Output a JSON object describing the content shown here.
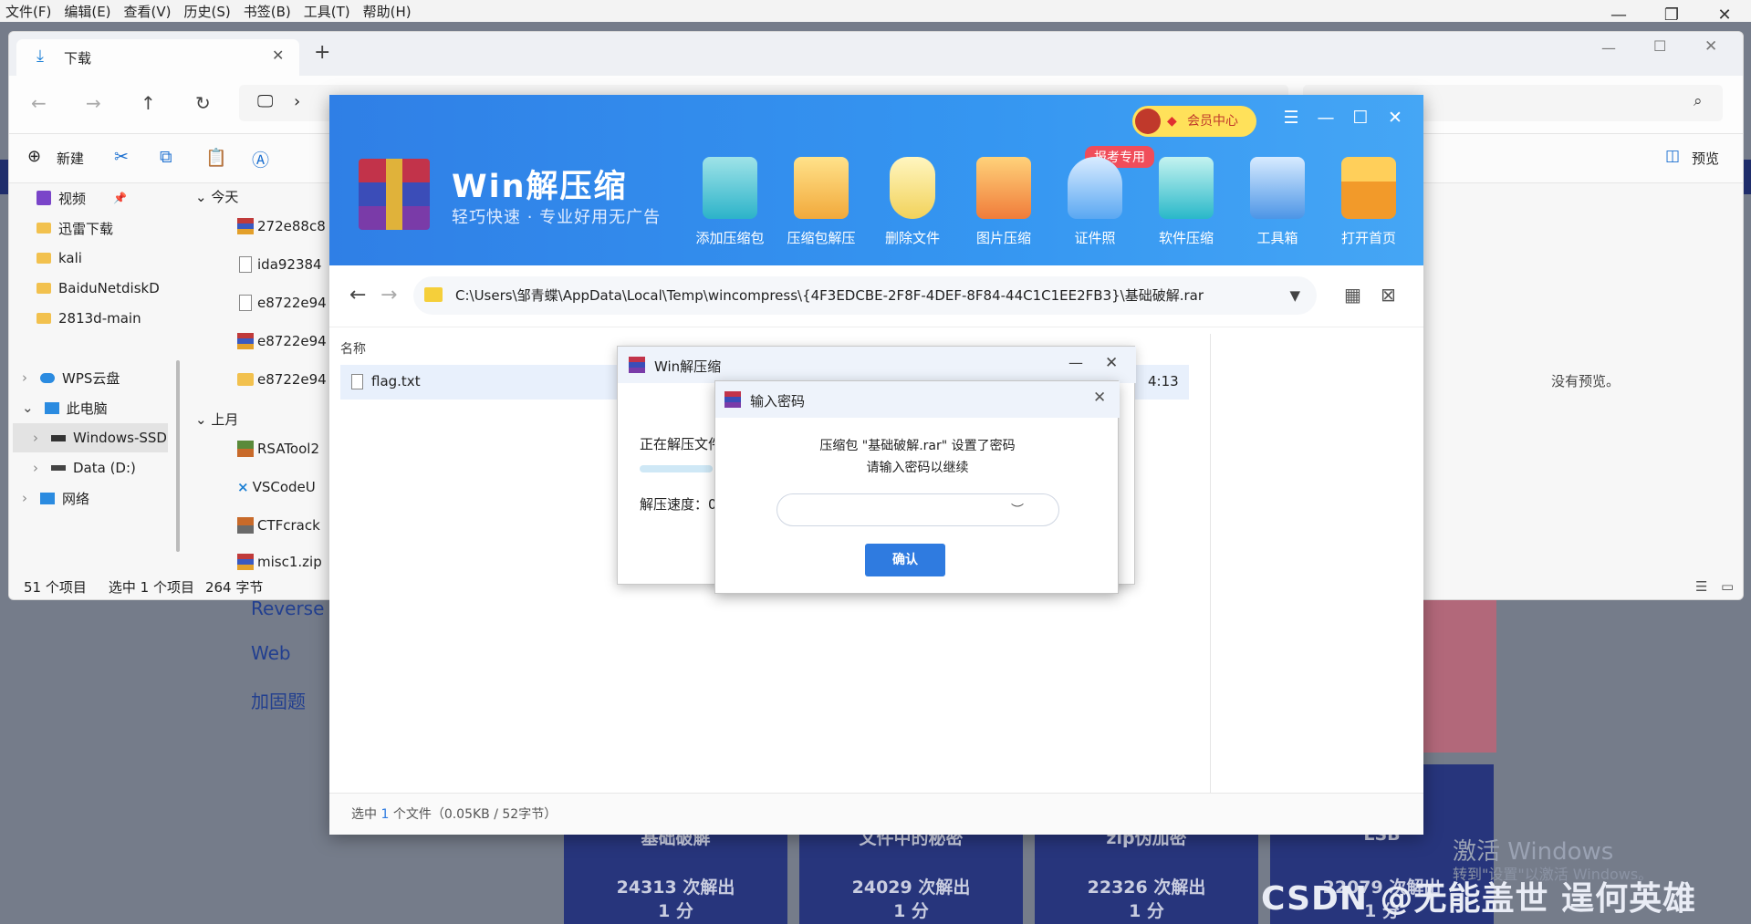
{
  "menu": [
    "文件(F)",
    "编辑(E)",
    "查看(V)",
    "历史(S)",
    "书签(B)",
    "工具(T)",
    "帮助(H)"
  ],
  "window_caps": [
    "—",
    "❐",
    "✕"
  ],
  "ctf": {
    "links": [
      "Reverse",
      "Web",
      "加固题"
    ],
    "cards": [
      {
        "title": "基础破解",
        "solves": "24313 次解出",
        "score": "1 分"
      },
      {
        "title": "文件中的秘密",
        "solves": "24029 次解出",
        "score": "1 分"
      },
      {
        "title": "zip伪加密",
        "solves": "22326 次解出",
        "score": "1 分"
      },
      {
        "title": "LSB",
        "solves": "22079 次解出",
        "score": "1 分"
      }
    ]
  },
  "watermark": {
    "activate": "激活 Windows",
    "activate_sub": "转到\"设置\"以激活 Windows。",
    "csdn": "CSDN @无能盖世 逞何英雄"
  },
  "explorer": {
    "tab_title": "下载",
    "new_button": "新建",
    "preview_button": "预览",
    "no_preview": "没有预览。",
    "sidebar": [
      "视频",
      "迅雷下载",
      "kali",
      "BaiduNetdiskD",
      "2813d-main",
      "WPS云盘",
      "此电脑",
      "Windows-SSD",
      "Data (D:)",
      "网络"
    ],
    "groups": [
      "今天",
      "上月"
    ],
    "files_today": [
      "272e88c8",
      "ida92384",
      "e8722e94",
      "e8722e94",
      "e8722e94"
    ],
    "files_month": [
      "RSATool2",
      "VSCodeU",
      "CTFcrack",
      "misc1.zip"
    ],
    "status": {
      "count": "51 个项目",
      "selected": "选中 1 个项目",
      "size": "264 字节"
    }
  },
  "winrar": {
    "title": "Win解压缩",
    "subtitle": "轻巧快速 · 专业好用无广告",
    "vip": "会员中心",
    "tag": "报考专用",
    "tools": [
      "添加压缩包",
      "压缩包解压",
      "删除文件",
      "图片压缩",
      "证件照",
      "软件压缩",
      "工具箱",
      "打开首页"
    ],
    "path": "C:\\Users\\邹青蝶\\AppData\\Local\\Temp\\wincompress\\{4F3EDCBE-2F8F-4DEF-8F84-44C1C1EE2FB3}\\基础破解.rar",
    "col_name": "名称",
    "file_name": "flag.txt",
    "file_time": "4:13",
    "status_prefix": "选中 ",
    "status_count": "1",
    "status_suffix": " 个文件（0.05KB / 52字节）"
  },
  "progress_dialog": {
    "title": "Win解压缩",
    "extracting": "正在解压文件",
    "speed": "解压速度：0"
  },
  "password_dialog": {
    "title": "输入密码",
    "line1": "压缩包 \"基础破解.rar\" 设置了密码",
    "line2": "请输入密码以继续",
    "placeholder": "",
    "ok": "确认"
  },
  "colors": {
    "accent": "#2f7be0",
    "header": "#3596f1",
    "ctf_card": "#27357c"
  }
}
